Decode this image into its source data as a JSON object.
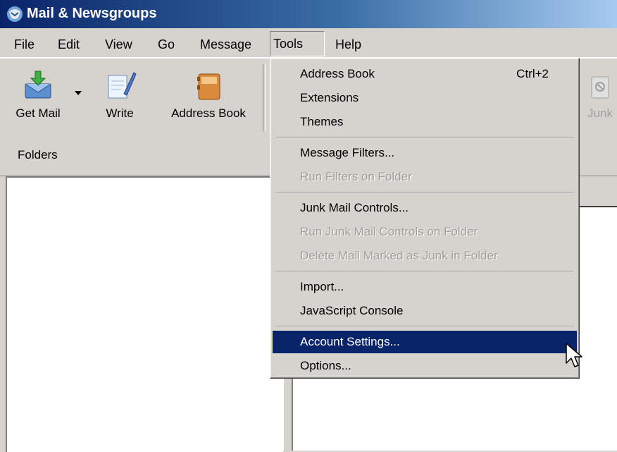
{
  "window": {
    "title": "Mail & Newsgroups",
    "app_icon": "mozilla-mail-icon"
  },
  "menubar": {
    "items": [
      {
        "label": "File",
        "active": false
      },
      {
        "label": "Edit",
        "active": false
      },
      {
        "label": "View",
        "active": false
      },
      {
        "label": "Go",
        "active": false
      },
      {
        "label": "Message",
        "active": false
      },
      {
        "label": "Tools",
        "active": true
      },
      {
        "label": "Help",
        "active": false
      }
    ]
  },
  "toolbar": {
    "buttons": [
      {
        "label": "Get Mail",
        "icon": "get-mail-icon",
        "enabled": true
      },
      {
        "label": "Write",
        "icon": "write-icon",
        "enabled": true
      },
      {
        "label": "Address Book",
        "icon": "address-book-icon",
        "enabled": true
      },
      {
        "label": "Junk",
        "icon": "junk-icon",
        "enabled": false
      }
    ]
  },
  "folders": {
    "header_label": "Folders"
  },
  "tools_menu": {
    "items": [
      {
        "label": "Address Book",
        "shortcut": "Ctrl+2",
        "enabled": true,
        "highlighted": false
      },
      {
        "label": "Extensions",
        "enabled": true,
        "highlighted": false
      },
      {
        "label": "Themes",
        "enabled": true,
        "highlighted": false
      },
      {
        "label": "Message Filters...",
        "enabled": true,
        "highlighted": false
      },
      {
        "label": "Run Filters on Folder",
        "enabled": false,
        "highlighted": false
      },
      {
        "label": "Junk Mail Controls...",
        "enabled": true,
        "highlighted": false
      },
      {
        "label": "Run Junk Mail Controls on Folder",
        "enabled": false,
        "highlighted": false
      },
      {
        "label": "Delete Mail Marked as Junk in Folder",
        "enabled": false,
        "highlighted": false
      },
      {
        "label": "Import...",
        "enabled": true,
        "highlighted": false
      },
      {
        "label": "JavaScript Console",
        "enabled": true,
        "highlighted": false
      },
      {
        "label": "Account Settings...",
        "enabled": true,
        "highlighted": true
      },
      {
        "label": "Options...",
        "enabled": true,
        "highlighted": false
      }
    ]
  },
  "colors": {
    "highlight": "#0a246a",
    "face": "#d6d3ce",
    "title_start": "#0a246a",
    "title_end": "#a6caf0"
  }
}
